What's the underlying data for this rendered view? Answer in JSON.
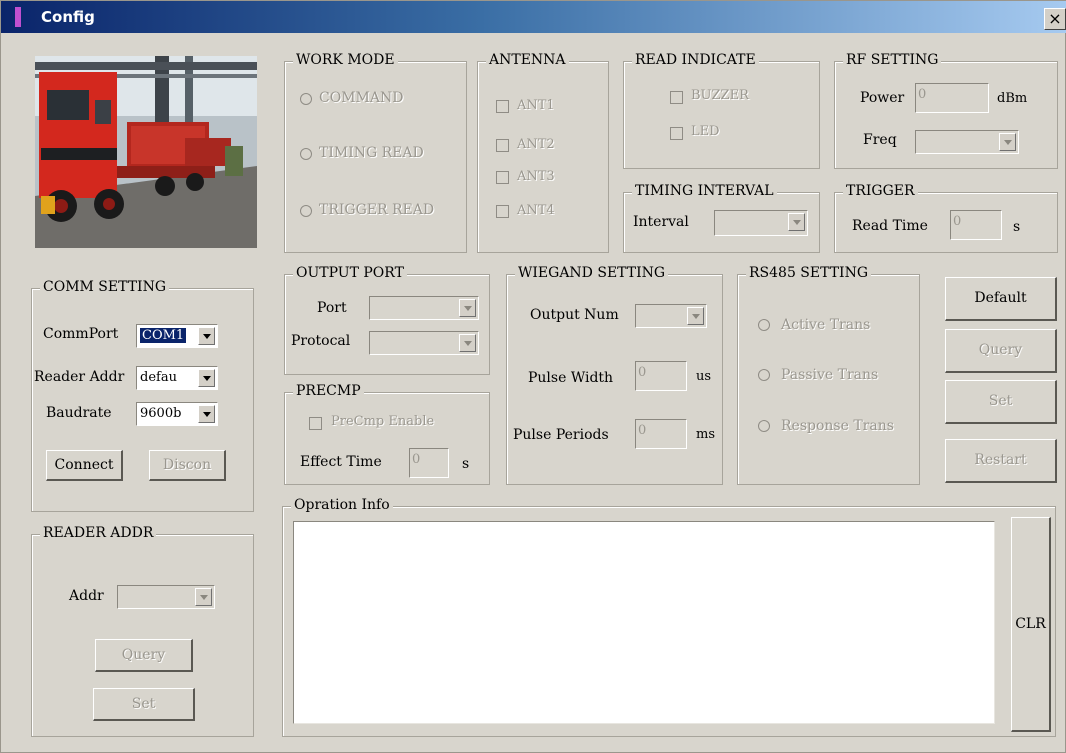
{
  "window": {
    "title": "Config",
    "close_label": "×"
  },
  "work_mode": {
    "title": "WORK MODE",
    "options": [
      "COMMAND",
      "TIMING READ",
      "TRIGGER READ"
    ]
  },
  "antenna": {
    "title": "ANTENNA",
    "options": [
      "ANT1",
      "ANT2",
      "ANT3",
      "ANT4"
    ]
  },
  "read_indicate": {
    "title": "READ INDICATE",
    "options": [
      "BUZZER",
      "LED"
    ]
  },
  "rf_setting": {
    "title": "RF SETTING",
    "power_label": "Power",
    "power_value": "0",
    "power_unit": "dBm",
    "freq_label": "Freq"
  },
  "timing_interval": {
    "title": "TIMING INTERVAL",
    "interval_label": "Interval"
  },
  "trigger": {
    "title": "TRIGGER",
    "read_time_label": "Read Time",
    "read_time_value": "0",
    "unit": "s"
  },
  "comm_setting": {
    "title": "COMM SETTING",
    "commport_label": "CommPort",
    "commport_value": "COM1",
    "reader_addr_label": "Reader Addr",
    "reader_addr_value": "defau",
    "baudrate_label": "Baudrate",
    "baudrate_value": "9600b",
    "connect_label": "Connect",
    "discon_label": "Discon"
  },
  "output_port": {
    "title": "OUTPUT PORT",
    "port_label": "Port",
    "protocol_label": "Protocal"
  },
  "precmp": {
    "title": "PRECMP",
    "enable_label": "PreCmp Enable",
    "effect_time_label": "Effect Time",
    "effect_time_value": "0",
    "unit": "s"
  },
  "wiegand": {
    "title": "WIEGAND SETTING",
    "output_num_label": "Output Num",
    "pulse_width_label": "Pulse Width",
    "pulse_width_value": "0",
    "pulse_width_unit": "us",
    "pulse_periods_label": "Pulse Periods",
    "pulse_periods_value": "0",
    "pulse_periods_unit": "ms"
  },
  "rs485": {
    "title": "RS485 SETTING",
    "options": [
      "Active Trans",
      "Passive Trans",
      "Response Trans"
    ]
  },
  "actions": {
    "default": "Default",
    "query": "Query",
    "set": "Set",
    "restart": "Restart"
  },
  "reader_addr": {
    "title": "READER ADDR",
    "addr_label": "Addr",
    "query": "Query",
    "set": "Set"
  },
  "operation_info": {
    "title": "Opration Info",
    "clr": "CLR"
  },
  "colors": {
    "titlebar_start": "#0a246a",
    "titlebar_end": "#a6caf0",
    "dialog_bg": "#d8d5cd",
    "disabled_text": "#9a978f"
  },
  "image": {
    "description": "photo-of-container-truck"
  }
}
